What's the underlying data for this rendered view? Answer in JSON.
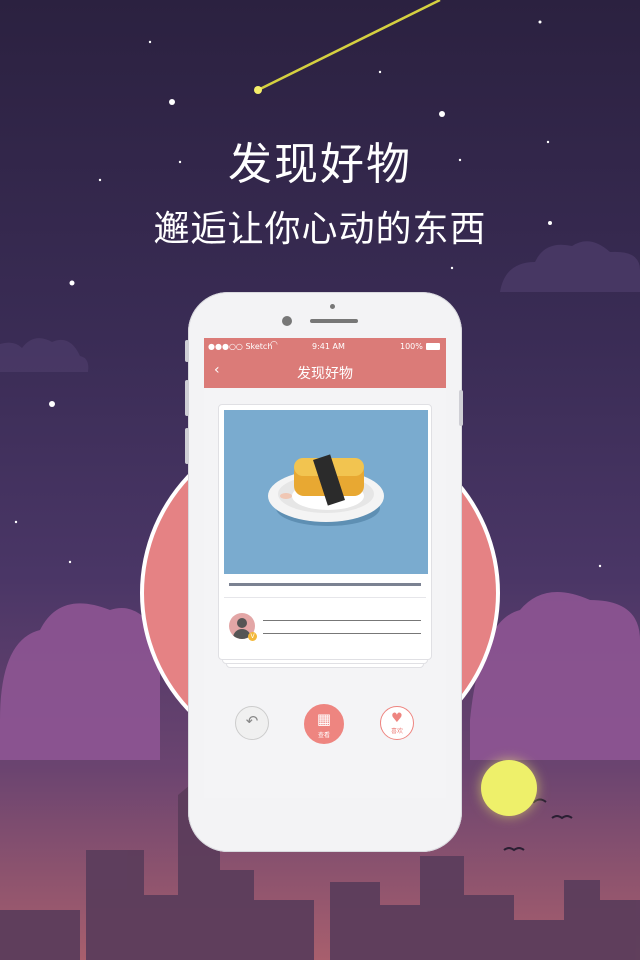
{
  "headline": {
    "title": "发现好物",
    "subtitle": "邂逅让你心动的东西"
  },
  "status_bar": {
    "carrier": "●●●○○ Sketch",
    "time": "9:41 AM",
    "battery": "100%"
  },
  "nav": {
    "title": "发现好物",
    "back_icon": "chevron-left-icon"
  },
  "actions": [
    {
      "icon": "undo-arrow-icon",
      "label": ""
    },
    {
      "icon": "gift-icon",
      "label": "查看"
    },
    {
      "icon": "heart-icon",
      "label": "喜欢"
    }
  ],
  "colors": {
    "accent": "#db7b78",
    "circle": "#e58284",
    "moon": "#eef06a",
    "image_bg": "#7aabcf"
  }
}
